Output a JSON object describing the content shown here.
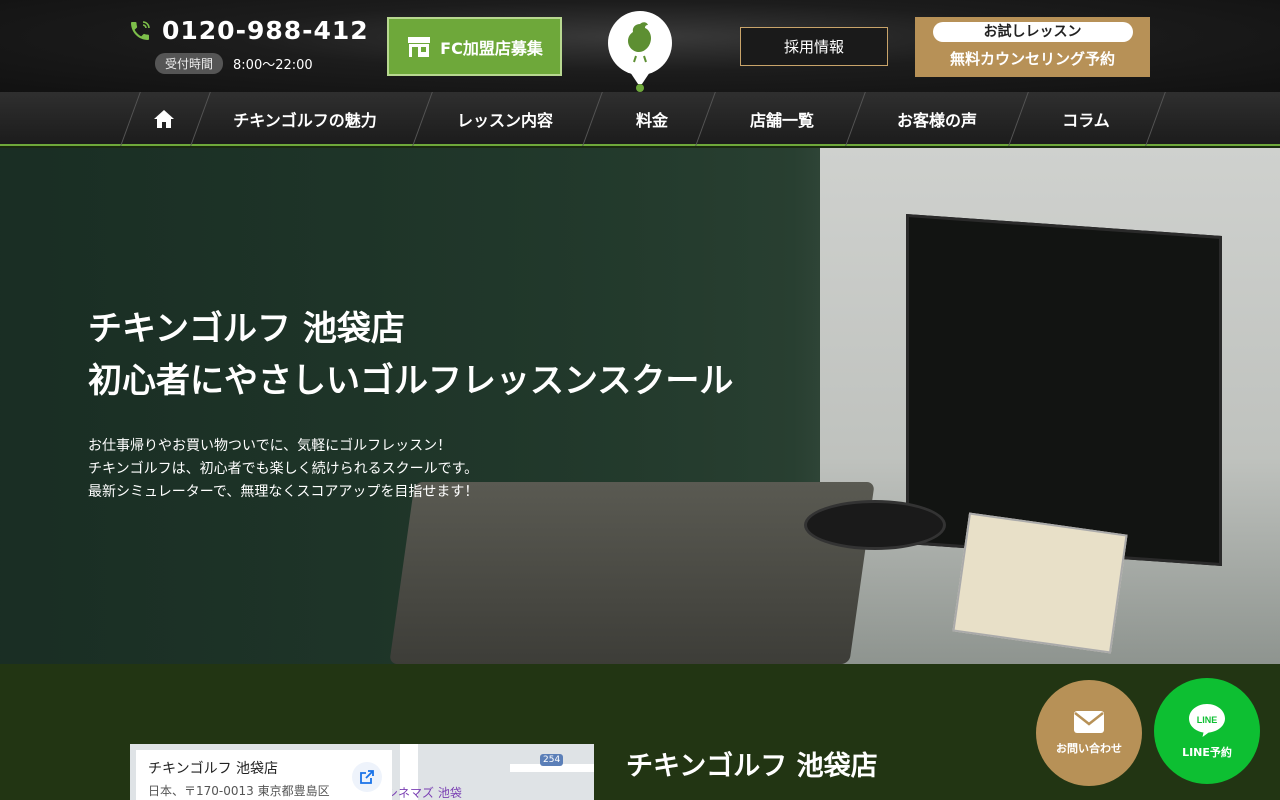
{
  "header": {
    "phone": "0120-988-412",
    "hours_label": "受付時間",
    "hours_time": "8:00～22:00",
    "fc_button": "FC加盟店募集",
    "recruit_button": "採用情報",
    "trial_pill": "お試しレッスン",
    "trial_main": "無料カウンセリング予約"
  },
  "nav": {
    "items": [
      "チキンゴルフの魅力",
      "レッスン内容",
      "料金",
      "店舗一覧",
      "お客様の声",
      "コラム"
    ]
  },
  "hero": {
    "title_line1": "チキンゴルフ 池袋店",
    "title_line2": "初心者にやさしいゴルフレッスンスクール",
    "desc_line1": "お仕事帰りやお買い物ついでに、気軽にゴルフレッスン！",
    "desc_line2": "チキンゴルフは、初心者でも楽しく続けられるスクールです。",
    "desc_line3": "最新シミュレーターで、無理なくスコアアップを目指せます！"
  },
  "map": {
    "title": "チキンゴルフ 池袋店",
    "address": "日本、〒170-0013 東京都豊島区",
    "label": "シネマズ 池袋",
    "route": "254"
  },
  "store_name": "チキンゴルフ 池袋店",
  "floating": {
    "contact": "お問い合わせ",
    "line_icon_text": "LINE",
    "line": "LINE予約"
  },
  "colors": {
    "accent_green": "#6ea83a",
    "gold": "#b79157",
    "line_green": "#0dbf32",
    "lower_bg": "#223513"
  }
}
